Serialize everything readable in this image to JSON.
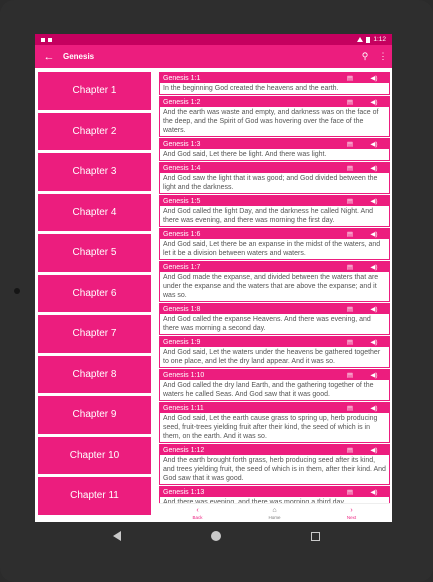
{
  "status": {
    "time": "1:12"
  },
  "appbar": {
    "title": "Genesis",
    "back_icon": "arrow-left-icon",
    "search_icon": "search-icon",
    "menu_icon": "more-vert-icon"
  },
  "chapters": [
    "Chapter 1",
    "Chapter 2",
    "Chapter 3",
    "Chapter 4",
    "Chapter 5",
    "Chapter 6",
    "Chapter 7",
    "Chapter 8",
    "Chapter 9",
    "Chapter 10",
    "Chapter 11"
  ],
  "verses": [
    {
      "ref": "Genesis 1:1",
      "text": "In the beginning God created the heavens and the earth."
    },
    {
      "ref": "Genesis 1:2",
      "text": "And the earth was waste and empty, and darkness was on the face of the deep, and the Spirit of God was hovering over the face of the waters."
    },
    {
      "ref": "Genesis 1:3",
      "text": "And God said, Let there be light. And there was light."
    },
    {
      "ref": "Genesis 1:4",
      "text": "And God saw the light that it was good; and God divided between the light and the darkness."
    },
    {
      "ref": "Genesis 1:5",
      "text": "And God called the light Day, and the darkness he called Night. And there was evening, and there was morning the first day."
    },
    {
      "ref": "Genesis 1:6",
      "text": "And God said, Let there be an expanse in the midst of the waters, and let it be a division between waters and waters."
    },
    {
      "ref": "Genesis 1:7",
      "text": "And God made the expanse, and divided between the waters that are under the expanse and the waters that are above the expanse; and it was so."
    },
    {
      "ref": "Genesis 1:8",
      "text": "And God called the expanse Heavens. And there was evening, and there was morning a second day."
    },
    {
      "ref": "Genesis 1:9",
      "text": "And God said, Let the waters under the heavens be gathered together to one place, and let the dry land appear. And it was so."
    },
    {
      "ref": "Genesis 1:10",
      "text": "And God called the dry land Earth, and the gathering together of the waters he called Seas. And God saw that it was good."
    },
    {
      "ref": "Genesis 1:11",
      "text": "And God said, Let the earth cause grass to spring up, herb producing seed, fruit-trees yielding fruit after their kind, the seed of which is in them, on the earth. And it was so."
    },
    {
      "ref": "Genesis 1:12",
      "text": "And the earth brought forth grass, herb producing seed after its kind, and trees yielding fruit, the seed of which is in them, after their kind. And God saw that it was good."
    },
    {
      "ref": "Genesis 1:13",
      "text": "And there was evening, and there was morning a third day."
    }
  ],
  "verse_icons": {
    "copy": "clipboard-icon",
    "speak": "speaker-icon"
  },
  "bottomnav": {
    "back": "Back",
    "home": "Home",
    "next": "Next"
  },
  "colors": {
    "primary": "#ec1d7e",
    "status": "#c5005f"
  }
}
